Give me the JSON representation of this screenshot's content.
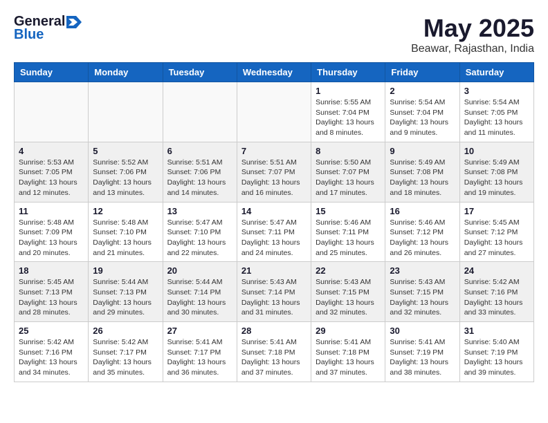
{
  "logo": {
    "general": "General",
    "blue": "Blue"
  },
  "header": {
    "title": "May 2025",
    "subtitle": "Beawar, Rajasthan, India"
  },
  "weekdays": [
    "Sunday",
    "Monday",
    "Tuesday",
    "Wednesday",
    "Thursday",
    "Friday",
    "Saturday"
  ],
  "weeks": [
    [
      {
        "day": "",
        "content": ""
      },
      {
        "day": "",
        "content": ""
      },
      {
        "day": "",
        "content": ""
      },
      {
        "day": "",
        "content": ""
      },
      {
        "day": "1",
        "content": "Sunrise: 5:55 AM\nSunset: 7:04 PM\nDaylight: 13 hours\nand 8 minutes."
      },
      {
        "day": "2",
        "content": "Sunrise: 5:54 AM\nSunset: 7:04 PM\nDaylight: 13 hours\nand 9 minutes."
      },
      {
        "day": "3",
        "content": "Sunrise: 5:54 AM\nSunset: 7:05 PM\nDaylight: 13 hours\nand 11 minutes."
      }
    ],
    [
      {
        "day": "4",
        "content": "Sunrise: 5:53 AM\nSunset: 7:05 PM\nDaylight: 13 hours\nand 12 minutes."
      },
      {
        "day": "5",
        "content": "Sunrise: 5:52 AM\nSunset: 7:06 PM\nDaylight: 13 hours\nand 13 minutes."
      },
      {
        "day": "6",
        "content": "Sunrise: 5:51 AM\nSunset: 7:06 PM\nDaylight: 13 hours\nand 14 minutes."
      },
      {
        "day": "7",
        "content": "Sunrise: 5:51 AM\nSunset: 7:07 PM\nDaylight: 13 hours\nand 16 minutes."
      },
      {
        "day": "8",
        "content": "Sunrise: 5:50 AM\nSunset: 7:07 PM\nDaylight: 13 hours\nand 17 minutes."
      },
      {
        "day": "9",
        "content": "Sunrise: 5:49 AM\nSunset: 7:08 PM\nDaylight: 13 hours\nand 18 minutes."
      },
      {
        "day": "10",
        "content": "Sunrise: 5:49 AM\nSunset: 7:08 PM\nDaylight: 13 hours\nand 19 minutes."
      }
    ],
    [
      {
        "day": "11",
        "content": "Sunrise: 5:48 AM\nSunset: 7:09 PM\nDaylight: 13 hours\nand 20 minutes."
      },
      {
        "day": "12",
        "content": "Sunrise: 5:48 AM\nSunset: 7:10 PM\nDaylight: 13 hours\nand 21 minutes."
      },
      {
        "day": "13",
        "content": "Sunrise: 5:47 AM\nSunset: 7:10 PM\nDaylight: 13 hours\nand 22 minutes."
      },
      {
        "day": "14",
        "content": "Sunrise: 5:47 AM\nSunset: 7:11 PM\nDaylight: 13 hours\nand 24 minutes."
      },
      {
        "day": "15",
        "content": "Sunrise: 5:46 AM\nSunset: 7:11 PM\nDaylight: 13 hours\nand 25 minutes."
      },
      {
        "day": "16",
        "content": "Sunrise: 5:46 AM\nSunset: 7:12 PM\nDaylight: 13 hours\nand 26 minutes."
      },
      {
        "day": "17",
        "content": "Sunrise: 5:45 AM\nSunset: 7:12 PM\nDaylight: 13 hours\nand 27 minutes."
      }
    ],
    [
      {
        "day": "18",
        "content": "Sunrise: 5:45 AM\nSunset: 7:13 PM\nDaylight: 13 hours\nand 28 minutes."
      },
      {
        "day": "19",
        "content": "Sunrise: 5:44 AM\nSunset: 7:13 PM\nDaylight: 13 hours\nand 29 minutes."
      },
      {
        "day": "20",
        "content": "Sunrise: 5:44 AM\nSunset: 7:14 PM\nDaylight: 13 hours\nand 30 minutes."
      },
      {
        "day": "21",
        "content": "Sunrise: 5:43 AM\nSunset: 7:14 PM\nDaylight: 13 hours\nand 31 minutes."
      },
      {
        "day": "22",
        "content": "Sunrise: 5:43 AM\nSunset: 7:15 PM\nDaylight: 13 hours\nand 32 minutes."
      },
      {
        "day": "23",
        "content": "Sunrise: 5:43 AM\nSunset: 7:15 PM\nDaylight: 13 hours\nand 32 minutes."
      },
      {
        "day": "24",
        "content": "Sunrise: 5:42 AM\nSunset: 7:16 PM\nDaylight: 13 hours\nand 33 minutes."
      }
    ],
    [
      {
        "day": "25",
        "content": "Sunrise: 5:42 AM\nSunset: 7:16 PM\nDaylight: 13 hours\nand 34 minutes."
      },
      {
        "day": "26",
        "content": "Sunrise: 5:42 AM\nSunset: 7:17 PM\nDaylight: 13 hours\nand 35 minutes."
      },
      {
        "day": "27",
        "content": "Sunrise: 5:41 AM\nSunset: 7:17 PM\nDaylight: 13 hours\nand 36 minutes."
      },
      {
        "day": "28",
        "content": "Sunrise: 5:41 AM\nSunset: 7:18 PM\nDaylight: 13 hours\nand 37 minutes."
      },
      {
        "day": "29",
        "content": "Sunrise: 5:41 AM\nSunset: 7:18 PM\nDaylight: 13 hours\nand 37 minutes."
      },
      {
        "day": "30",
        "content": "Sunrise: 5:41 AM\nSunset: 7:19 PM\nDaylight: 13 hours\nand 38 minutes."
      },
      {
        "day": "31",
        "content": "Sunrise: 5:40 AM\nSunset: 7:19 PM\nDaylight: 13 hours\nand 39 minutes."
      }
    ]
  ]
}
